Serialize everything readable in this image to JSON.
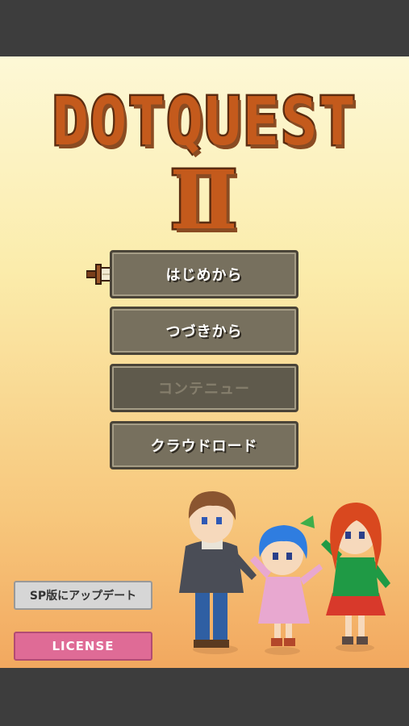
{
  "game": {
    "logo_main": "DOTQUEST",
    "logo_numeral": "Ⅱ"
  },
  "menu": {
    "start_new": "はじめから",
    "continue_save": "つづきから",
    "continue_disabled": "コンテニュー",
    "cloud_load": "クラウドロード"
  },
  "side": {
    "sp_update": "SP版にアップデート",
    "license": "LICENSE"
  },
  "colors": {
    "button": "#77705e",
    "license": "#df6b96",
    "logo": "#c45a1c"
  },
  "icons": {
    "cursor": "sword-icon",
    "characters": "party-illustration"
  }
}
